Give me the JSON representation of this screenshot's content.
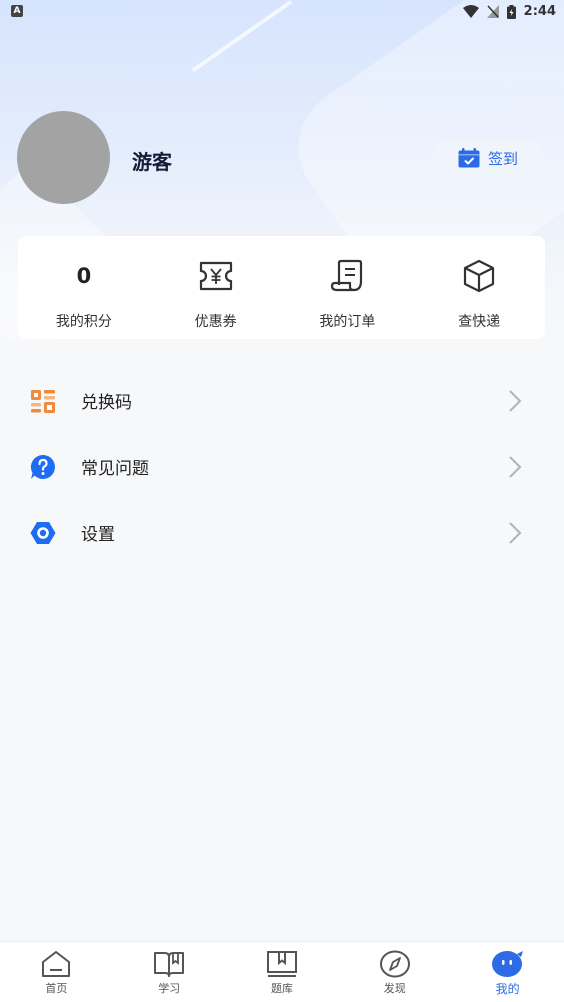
{
  "status_bar": {
    "time": "2:44",
    "left_badge": "A"
  },
  "profile": {
    "username": "游客",
    "signin_label": "签到"
  },
  "stats": [
    {
      "value": "0",
      "label": "我的积分"
    },
    {
      "icon": "coupon-icon",
      "label": "优惠券"
    },
    {
      "icon": "order-icon",
      "label": "我的订单"
    },
    {
      "icon": "package-icon",
      "label": "查快递"
    }
  ],
  "menu": [
    {
      "label": "兑换码",
      "icon": "redeem-code-icon",
      "color": "#f08a3c"
    },
    {
      "label": "常见问题",
      "icon": "question-icon",
      "color": "#1e6cf2"
    },
    {
      "label": "设置",
      "icon": "settings-hex-icon",
      "color": "#1e6cf2"
    }
  ],
  "tabs": [
    {
      "label": "首页",
      "icon": "home-icon"
    },
    {
      "label": "学习",
      "icon": "book-icon"
    },
    {
      "label": "题库",
      "icon": "question-bank-icon"
    },
    {
      "label": "发现",
      "icon": "compass-icon"
    },
    {
      "label": "我的",
      "icon": "mine-icon",
      "active": true
    }
  ],
  "accent_color": "#2c6ae6"
}
